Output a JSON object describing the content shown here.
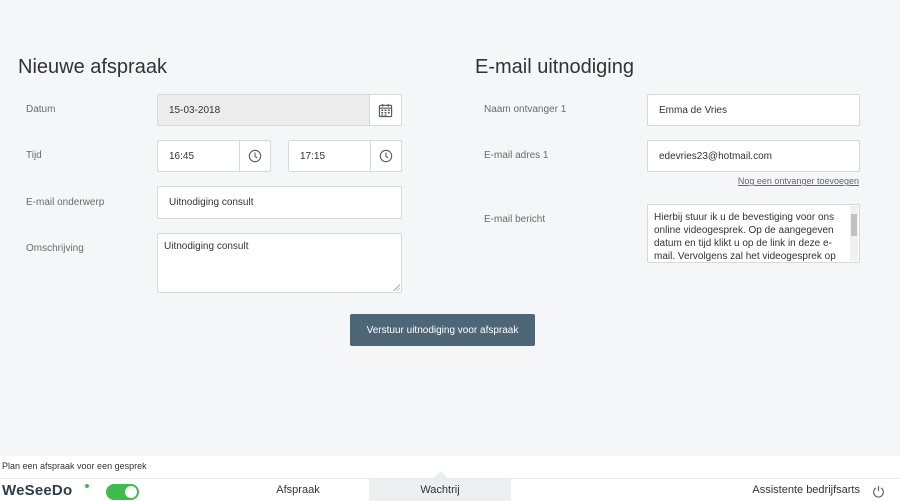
{
  "left": {
    "title": "Nieuwe afspraak",
    "date": {
      "label": "Datum",
      "value": "15-03-2018"
    },
    "time": {
      "label": "Tijd",
      "start": "16:45",
      "end": "17:15"
    },
    "subject": {
      "label": "E-mail onderwerp",
      "value": "Uitnodiging consult"
    },
    "description": {
      "label": "Omschrijving",
      "value": "Uitnodiging consult"
    }
  },
  "right": {
    "title": "E-mail uitnodiging",
    "recipient_name": {
      "label": "Naam ontvanger 1",
      "value": "Emma de Vries"
    },
    "recipient_email": {
      "label": "E-mail adres 1",
      "value": "edevries23@hotmail.com"
    },
    "add_recipient_link": "Nog een ontvanger toevoegen",
    "message": {
      "label": "E-mail bericht",
      "value": "Hierbij stuur ik u de bevestiging voor ons online videogesprek. Op de aangegeven datum en tijd klikt u op de link in deze e-mail. Vervolgens zal het videogesprek op uw scherm verschijnen en kunnen we het videogesprek starten. Tot"
    }
  },
  "submit_label": "Verstuur uitnodiging voor afspraak",
  "status_text": "Plan een afspraak voor een gesprek",
  "footer": {
    "logo": "WeSeeDo",
    "tabs": [
      {
        "label": "Afspraak",
        "active": false
      },
      {
        "label": "Wachtrij",
        "active": true
      }
    ],
    "user": "Assistente bedrijfsarts"
  },
  "colors": {
    "accent": "#4d6778",
    "toggle_on": "#3bbf4a",
    "background": "#f4f6f7"
  },
  "icons": [
    "calendar-icon",
    "clock-icon",
    "power-icon"
  ]
}
